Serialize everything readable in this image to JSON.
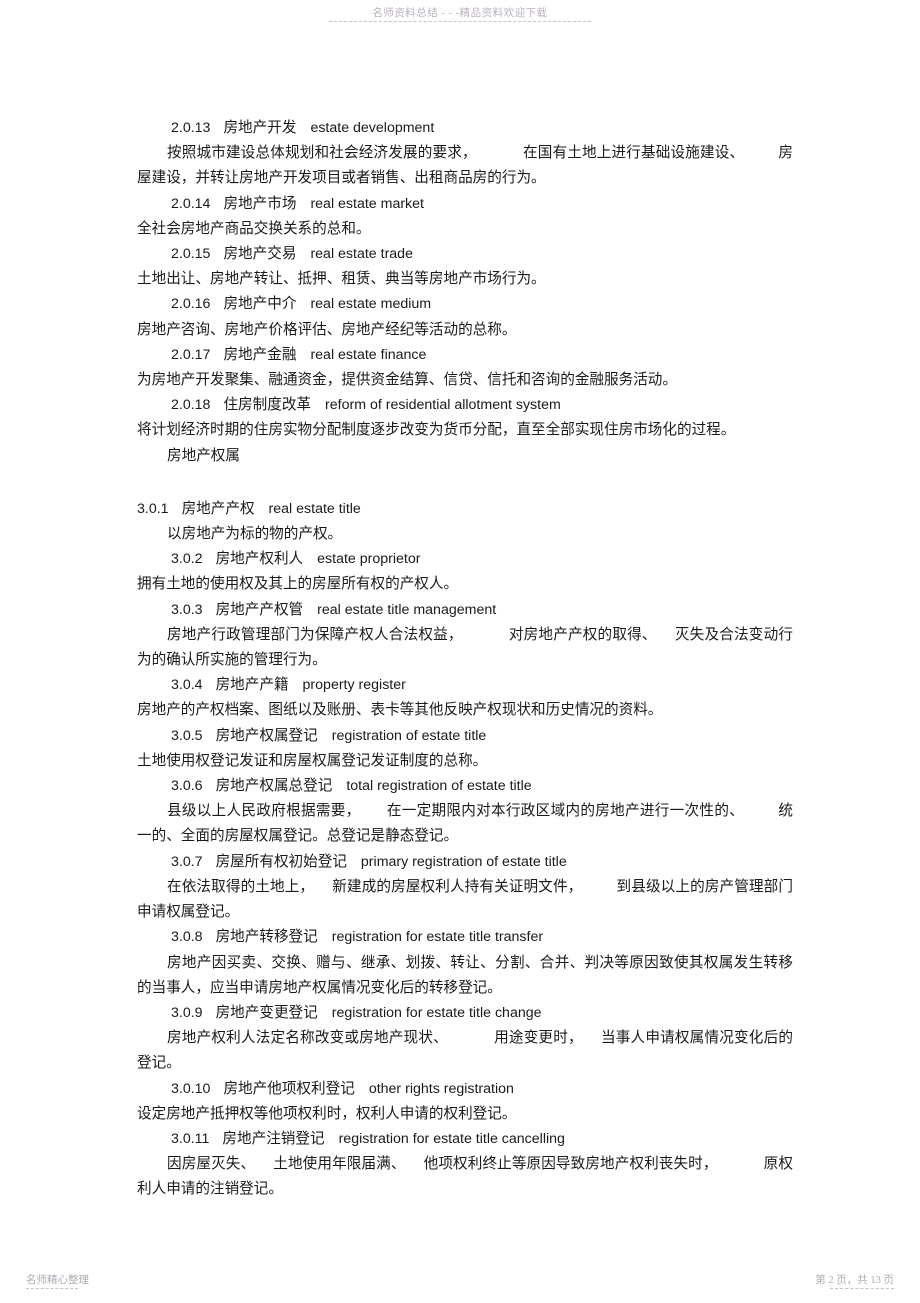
{
  "header": {
    "watermark": "名师资料总结 - - -精品资料欢迎下载"
  },
  "footer": {
    "left_watermark": "名师精心整理",
    "page_indicator": "第 2 页，共 13 页"
  },
  "document": {
    "section_heading": "房地产权属",
    "entries": [
      {
        "number": "2.0.13",
        "term_cn": "房地产开发",
        "term_en": "estate development",
        "definition_parts": [
          "按照城市建设总体规划和社会经济发展的要求，",
          "在国有土地上进行基础设施建设、",
          "房屋建设，并转让房地产开发项目或者销售、出租商品房的行为。"
        ],
        "definition": "按照城市建设总体规划和社会经济发展的要求， 在国有土地上进行基础设施建设、 房屋建设，并转让房地产开发项目或者销售、出租商品房的行为。"
      },
      {
        "number": "2.0.14",
        "term_cn": "房地产市场",
        "term_en": "real estate market",
        "definition": "全社会房地产商品交换关系的总和。"
      },
      {
        "number": "2.0.15",
        "term_cn": "房地产交易",
        "term_en": "real estate trade",
        "definition": "土地出让、房地产转让、抵押、租赁、典当等房地产市场行为。"
      },
      {
        "number": "2.0.16",
        "term_cn": "房地产中介",
        "term_en": "real estate medium",
        "definition": "房地产咨询、房地产价格评估、房地产经纪等活动的总称。"
      },
      {
        "number": "2.0.17",
        "term_cn": "房地产金融",
        "term_en": "real estate finance",
        "definition": "为房地产开发聚集、融通资金，提供资金结算、信贷、信托和咨询的金融服务活动。"
      },
      {
        "number": "2.0.18",
        "term_cn": "住房制度改革",
        "term_en": "reform of residential allotment system",
        "definition": "将计划经济时期的住房实物分配制度逐步改变为货币分配，直至全部实现住房市场化的过程。"
      },
      {
        "number": "3.0.1",
        "term_cn": "房地产产权",
        "term_en": "real estate title",
        "definition": "以房地产为标的物的产权。"
      },
      {
        "number": "3.0.2",
        "term_cn": "房地产权利人",
        "term_en": "estate proprietor",
        "definition": "拥有土地的使用权及其上的房屋所有权的产权人。"
      },
      {
        "number": "3.0.3",
        "term_cn": "房地产产权管",
        "term_en": "real estate title management",
        "definition_parts": [
          "房地产行政管理部门为保障产权人合法权益，",
          "对房地产产权的取得、",
          "灭失及合法变动行为的确认所实施的管理行为。"
        ],
        "definition": "房地产行政管理部门为保障产权人合法权益， 对房地产产权的取得、 灭失及合法变动行为的确认所实施的管理行为。"
      },
      {
        "number": "3.0.4",
        "term_cn": "房地产产籍",
        "term_en": "property register",
        "definition": "房地产的产权档案、图纸以及账册、表卡等其他反映产权现状和历史情况的资料。"
      },
      {
        "number": "3.0.5",
        "term_cn": "房地产权属登记",
        "term_en": "registration of estate title",
        "definition": "土地使用权登记发证和房屋权属登记发证制度的总称。"
      },
      {
        "number": "3.0.6",
        "term_cn": "房地产权属总登记",
        "term_en": "total registration of estate title",
        "definition_parts": [
          "县级以上人民政府根据需要，",
          "在一定期限内对本行政区域内的房地产进行一次性的、",
          "统一的、全面的房屋权属登记。总登记是静态登记。"
        ],
        "definition": "县级以上人民政府根据需要， 在一定期限内对本行政区域内的房地产进行一次性的、 统一的、全面的房屋权属登记。总登记是静态登记。"
      },
      {
        "number": "3.0.7",
        "term_cn": "房屋所有权初始登记",
        "term_en": "primary registration of estate title",
        "definition_parts": [
          "在依法取得的土地上，",
          "新建成的房屋权利人持有关证明文件，",
          "到县级以上的房产管理部门申请权属登记。"
        ],
        "definition": "在依法取得的土地上， 新建成的房屋权利人持有关证明文件， 到县级以上的房产管理部门申请权属登记。"
      },
      {
        "number": "3.0.8",
        "term_cn": "房地产转移登记",
        "term_en": "registration for estate title transfer",
        "definition": "房地产因买卖、交换、赠与、继承、划拨、转让、分割、合并、判决等原因致使其权属发生转移的当事人，应当申请房地产权属情况变化后的转移登记。"
      },
      {
        "number": "3.0.9",
        "term_cn": "房地产变更登记",
        "term_en": "registration for estate title change",
        "definition_parts": [
          "房地产权利人法定名称改变或房地产现状、",
          "用途变更时，",
          "当事人申请权属情况变化后的登记。"
        ],
        "definition": "房地产权利人法定名称改变或房地产现状、 用途变更时， 当事人申请权属情况变化后的登记。"
      },
      {
        "number": "3.0.10",
        "term_cn": "房地产他项权利登记",
        "term_en": "other rights registration",
        "definition": "设定房地产抵押权等他项权利时，权利人申请的权利登记。"
      },
      {
        "number": "3.0.11",
        "term_cn": "房地产注销登记",
        "term_en": "registration for estate title cancelling",
        "definition_parts": [
          "因房屋灭失、",
          "土地使用年限届满、",
          "他项权利终止等原因导致房地产权利丧失时，",
          "原权利人申请的注销登记。"
        ],
        "definition": "因房屋灭失、 土地使用年限届满、 他项权利终止等原因导致房地产权利丧失时， 原权利人申请的注销登记。"
      }
    ]
  }
}
